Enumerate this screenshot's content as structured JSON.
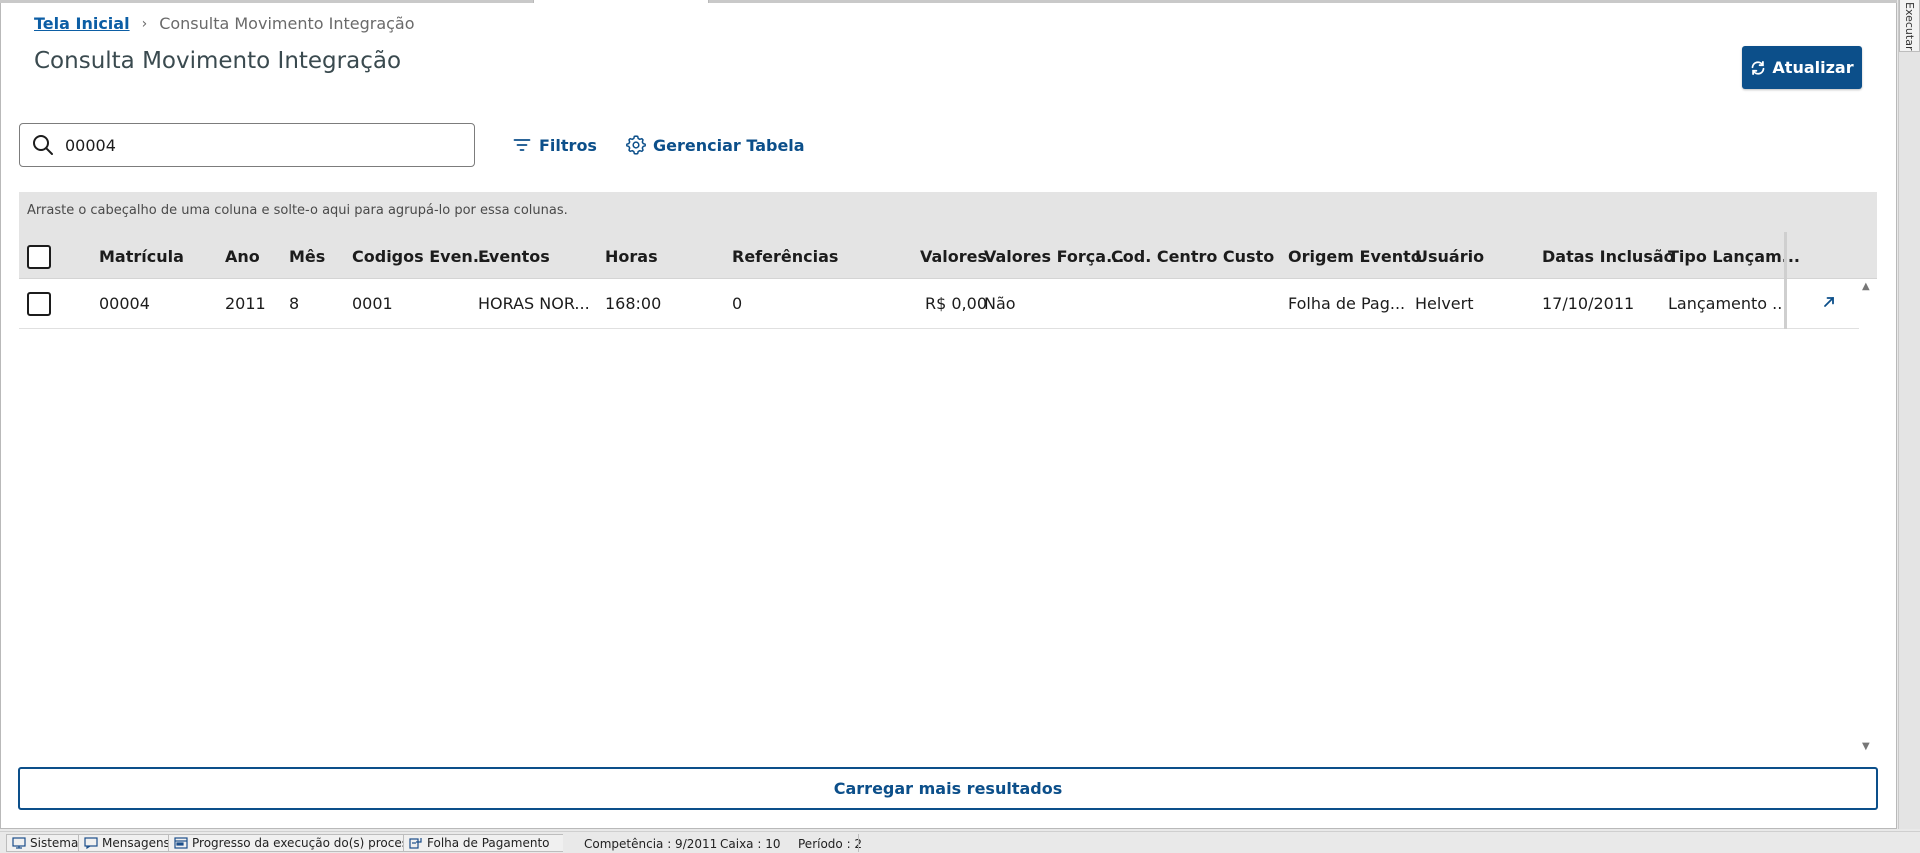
{
  "breadcrumb": {
    "home": "Tela Inicial",
    "separator": "›",
    "current": "Consulta Movimento Integração"
  },
  "page": {
    "title": "Consulta Movimento Integração"
  },
  "actions": {
    "refresh_label": "Atualizar",
    "refresh_icon": "refresh-icon"
  },
  "search": {
    "value": "00004",
    "icon": "search-icon"
  },
  "toolbar": {
    "filters_label": "Filtros",
    "filters_icon": "filter-icon",
    "manage_table_label": "Gerenciar Tabela",
    "manage_table_icon": "gear-icon"
  },
  "table": {
    "group_hint": "Arraste o cabeçalho de uma coluna e solte-o aqui para agrupá-lo por essa colunas.",
    "columns": [
      "Matrícula",
      "Ano",
      "Mês",
      "Codigos Even...",
      "Eventos",
      "Horas",
      "Referências",
      "Valores",
      "Valores Força...",
      "Cod. Centro Custo",
      "Origem Evento",
      "Usuário",
      "Datas Inclusão",
      "Tipo Lançam..."
    ],
    "rows": [
      [
        "00004",
        "2011",
        "8",
        "0001",
        "HORAS NOR...",
        "168:00",
        "0",
        "R$ 0,00",
        "Não",
        "",
        "Folha de Pag...",
        "Helvert",
        "17/10/2011",
        "Lançamento ..."
      ]
    ],
    "row_action_icon": "open-detail-icon"
  },
  "load_more_label": "Carregar mais resultados",
  "side_tab": {
    "label": "Executar"
  },
  "statusbar": {
    "sistema": "Sistema",
    "mensagens": "Mensagens",
    "progresso": "Progresso da execução do(s) processo(s)",
    "modulo": "Folha de Pagamento",
    "competencia": "Competência : 9/2011",
    "caixa": "Caixa : 10",
    "periodo": "Período : 2"
  }
}
